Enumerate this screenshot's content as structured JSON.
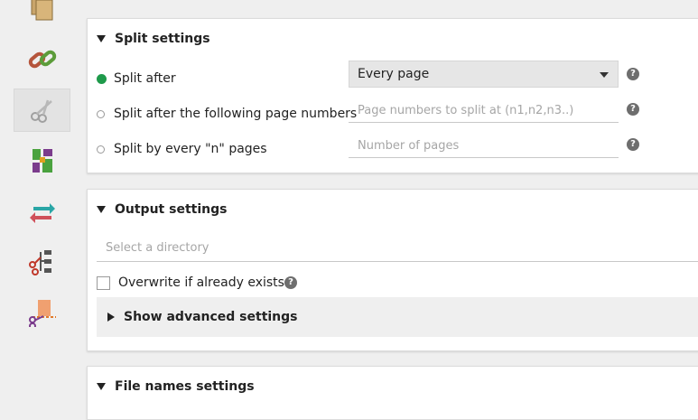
{
  "sidebar": {
    "items": [
      {
        "name": "merge",
        "icon": "documents-icon"
      },
      {
        "name": "link",
        "icon": "chain-link-icon"
      },
      {
        "name": "split",
        "icon": "scissors-icon",
        "selected": true
      },
      {
        "name": "mix",
        "icon": "mosaic-icon"
      },
      {
        "name": "rotate",
        "icon": "rotate-arrows-icon"
      },
      {
        "name": "split-by-bookmarks",
        "icon": "tree-scissors-icon"
      },
      {
        "name": "split-by-size",
        "icon": "cut-page-icon"
      }
    ]
  },
  "split_settings": {
    "title": "Split settings",
    "options": [
      {
        "label": "Split after",
        "checked": true
      },
      {
        "label": "Split after the following page numbers",
        "checked": false
      },
      {
        "label": "Split by every \"n\" pages",
        "checked": false
      }
    ],
    "split_after_select": {
      "value": "Every page"
    },
    "page_numbers_placeholder": "Page numbers to split at (n1,n2,n3..)",
    "number_of_pages_placeholder": "Number of pages",
    "help_glyph": "?"
  },
  "output_settings": {
    "title": "Output settings",
    "directory_placeholder": "Select a directory",
    "overwrite_label": "Overwrite if already exists",
    "overwrite_checked": false,
    "advanced_label": "Show advanced settings",
    "help_glyph": "?"
  },
  "file_names_settings": {
    "title": "File names settings"
  },
  "colors": {
    "accent_green": "#1f9a4b",
    "panel_bg": "#ffffff",
    "app_bg": "#efefef"
  }
}
